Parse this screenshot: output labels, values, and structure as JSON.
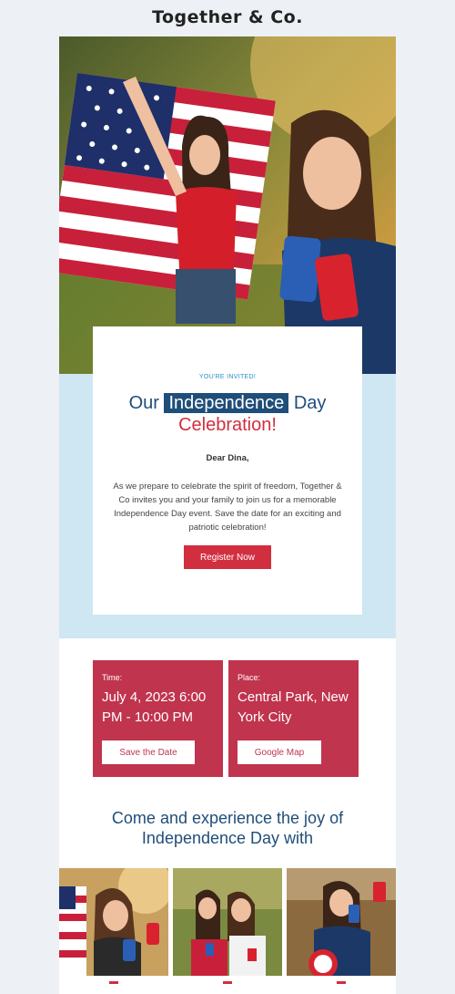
{
  "brand": {
    "name": "Together & Co."
  },
  "invite": {
    "eyebrow": "YOU'RE INVITED!",
    "headline_pre": "Our",
    "headline_highlight": "Independence",
    "headline_post": "Day",
    "headline_line2": "Celebration!",
    "greeting": "Dear Dina,",
    "body": "As we prepare to celebrate the spirit of freedom, Together & Co invites you and your family to join us for a memorable Independence Day event. Save the date for an exciting and patriotic celebration!",
    "cta_label": "Register Now"
  },
  "details": {
    "time_label": "Time:",
    "time_value": "July 4, 2023 6:00 PM - 10:00 PM",
    "time_button": "Save the Date",
    "place_label": "Place:",
    "place_value": "Central Park, New York City",
    "place_button": "Google Map"
  },
  "gallery": {
    "heading": "Come and experience the joy of Independence Day with"
  },
  "colors": {
    "navy": "#1f4e79",
    "red": "#d12f3f",
    "crimson": "#c0344e",
    "light_blue": "#cfe6f3"
  }
}
